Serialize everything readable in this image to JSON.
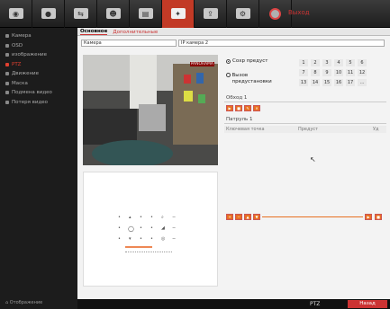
{
  "topbar": {
    "buttons": [
      {
        "name": "camera-toolbar-button",
        "icon": "camera-icon"
      },
      {
        "name": "record-toolbar-button",
        "icon": "record-icon"
      },
      {
        "name": "network-toolbar-button",
        "icon": "network-icon"
      },
      {
        "name": "user-toolbar-button",
        "icon": "user-icon"
      },
      {
        "name": "hdd-toolbar-button",
        "icon": "hdd-icon"
      },
      {
        "name": "ptz-toolbar-button",
        "icon": "ptz-icon",
        "active": true
      },
      {
        "name": "export-toolbar-button",
        "icon": "export-icon"
      },
      {
        "name": "maintenance-toolbar-button",
        "icon": "maintenance-icon"
      },
      {
        "name": "power-toolbar-button",
        "icon": "power-icon"
      }
    ],
    "exit_label": "Выход"
  },
  "sidebar": {
    "items": [
      {
        "label": "Камера"
      },
      {
        "label": "OSD"
      },
      {
        "label": "изображение"
      },
      {
        "label": "PTZ",
        "active": true
      },
      {
        "label": "Движение"
      },
      {
        "label": "Маска"
      },
      {
        "label": "Подмена видео"
      },
      {
        "label": "Потеря видео"
      }
    ],
    "bottom_label": "Отображение"
  },
  "main": {
    "tabs": [
      {
        "label": "Основное",
        "active": true
      },
      {
        "label": "Дополнительные",
        "active": false
      }
    ],
    "camera_label": "Камера",
    "camera_value": "IP камера 2",
    "preset": {
      "set_label": "Сохр предуст",
      "call_label": "Вызов предустановки",
      "numbers": [
        "1",
        "2",
        "3",
        "4",
        "5",
        "6",
        "7",
        "8",
        "9",
        "10",
        "11",
        "12",
        "13",
        "14",
        "15",
        "16",
        "17",
        "..."
      ]
    },
    "patrol_section": "Обход 1",
    "patrol2_section": "Патруль 1",
    "table_headers": [
      "Ключевая точка",
      "Предуст",
      "Уд"
    ],
    "video_overlay": "PANORAMA"
  },
  "bottombar": {
    "ptz_label": "PTZ",
    "back_label": "Назад"
  },
  "colors": {
    "accent": "#c33a26",
    "sidebar_bg": "#1c1c1c",
    "main_bg": "#f3f3f3"
  }
}
